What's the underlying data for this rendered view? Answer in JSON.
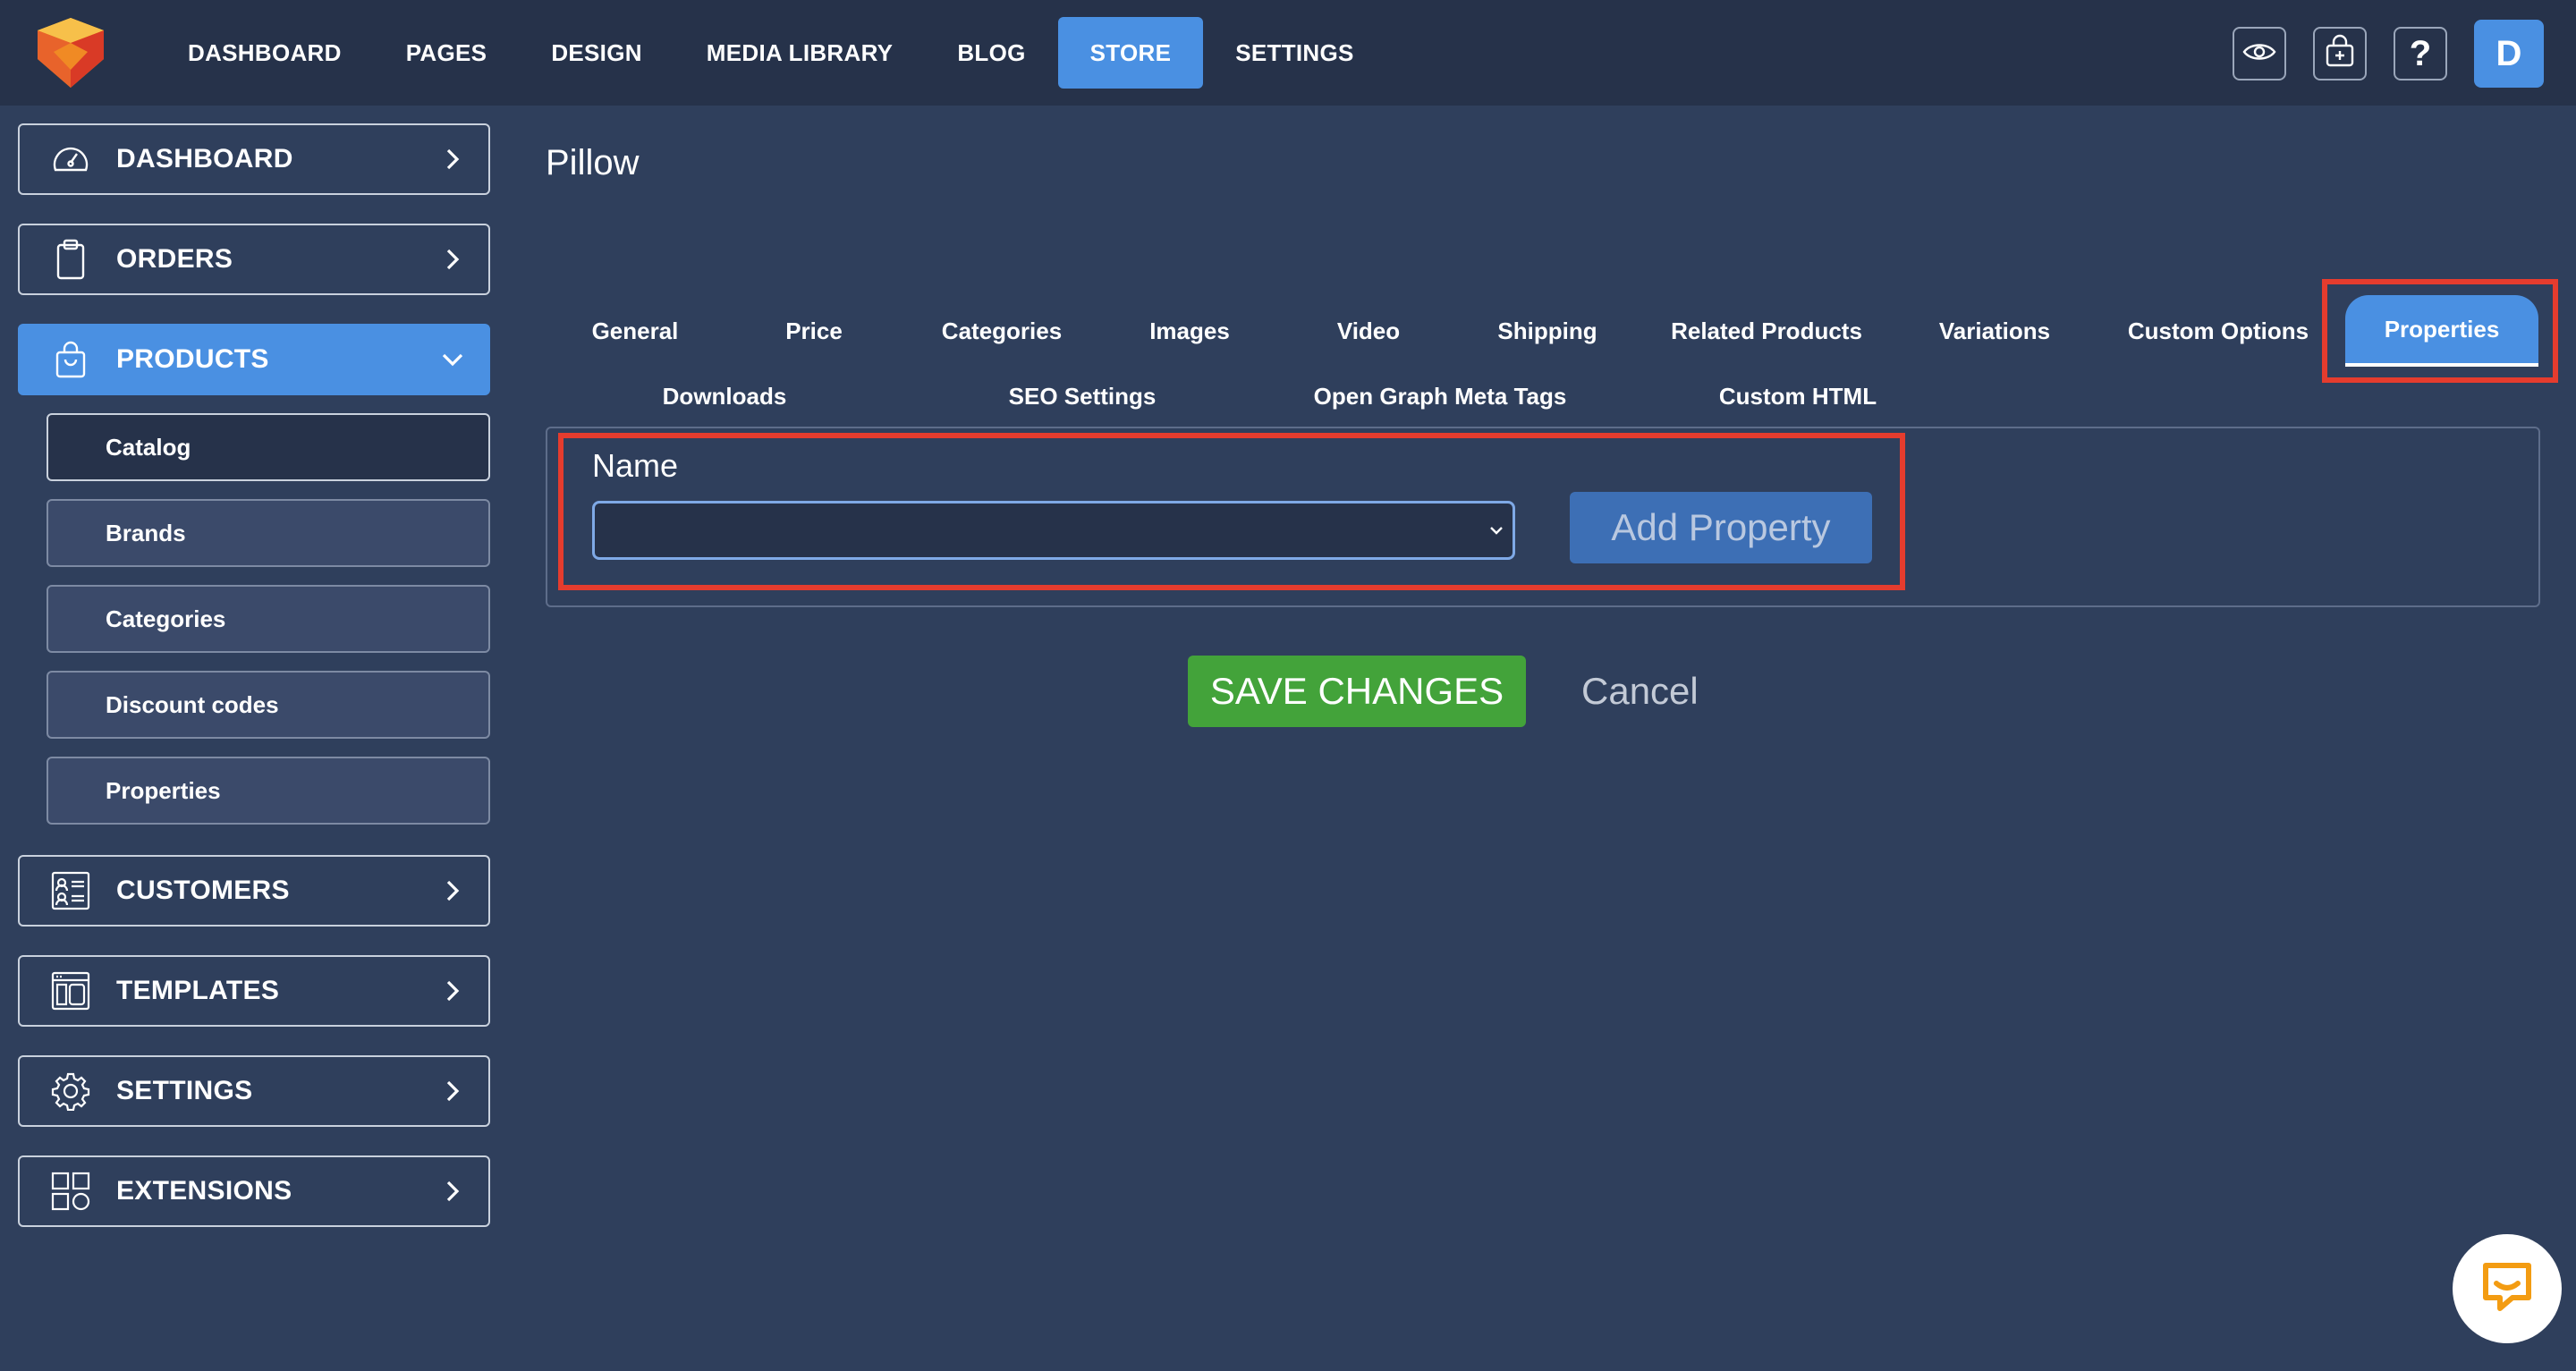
{
  "topnav": {
    "items": [
      "DASHBOARD",
      "PAGES",
      "DESIGN",
      "MEDIA LIBRARY",
      "BLOG",
      "STORE",
      "SETTINGS"
    ],
    "active": "STORE"
  },
  "top_icons": [
    "eye-icon",
    "store-icon",
    "help-icon"
  ],
  "help_label": "?",
  "avatar_initial": "D",
  "sidebar": {
    "dashboard": "DASHBOARD",
    "orders": "ORDERS",
    "products": "PRODUCTS",
    "sub": [
      "Catalog",
      "Brands",
      "Categories",
      "Discount codes",
      "Properties"
    ],
    "customers": "CUSTOMERS",
    "templates": "TEMPLATES",
    "settings": "SETTINGS",
    "extensions": "EXTENSIONS"
  },
  "page": {
    "title": "Pillow"
  },
  "tabs": {
    "row1": [
      "General",
      "Price",
      "Categories",
      "Images",
      "Video",
      "Shipping",
      "Related Products",
      "Variations",
      "Custom Options",
      "Properties"
    ],
    "row2": [
      "Downloads",
      "SEO Settings",
      "Open Graph Meta Tags",
      "Custom HTML"
    ],
    "active": "Properties"
  },
  "form": {
    "name_label": "Name",
    "name_value": "",
    "add_button": "Add Property"
  },
  "actions": {
    "save": "SAVE CHANGES",
    "cancel": "Cancel"
  },
  "colors": {
    "accent": "#4a90e2",
    "save": "#43a33a",
    "highlight": "#e53c2e",
    "topbar": "#26324a",
    "background": "#2f3f5c"
  }
}
